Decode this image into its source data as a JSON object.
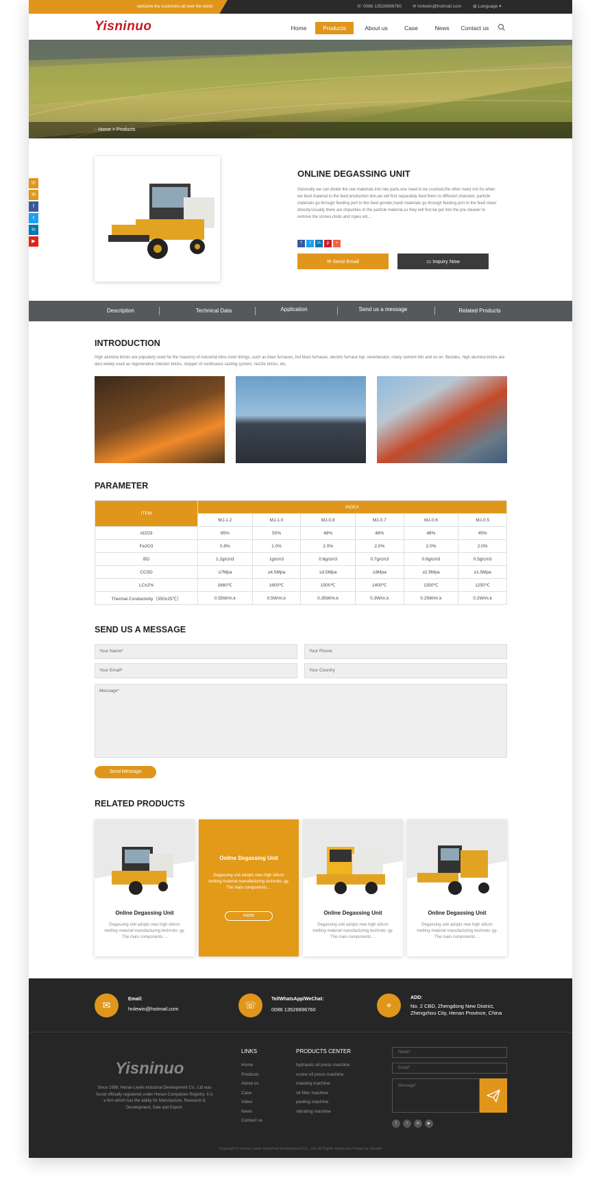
{
  "topbar": {
    "welcome": "welcome the customers all over the world",
    "phone": "0086 13526696760",
    "email": "hnlewin@hotmail.com",
    "language": "Language"
  },
  "brand": {
    "logo_text": "Yisninuo",
    "accent": "#e0961b",
    "dark": "#262626"
  },
  "nav": {
    "items": [
      {
        "label": "Home"
      },
      {
        "label": "Products"
      },
      {
        "label": "About us"
      },
      {
        "label": "Case"
      },
      {
        "label": "News"
      },
      {
        "label": "Contact us"
      }
    ],
    "active": "Products",
    "search_icon": "search-icon"
  },
  "breadcrumb": {
    "home": "Home",
    "separator": ">",
    "current": "Products"
  },
  "product": {
    "title": "ONLINE DEGASSING UNIT",
    "description": "Generally we can divide the raw materials into two parts,one need to be crushed,the other need not.So when we feed material to the feed production line,we will first separately feed them to different channels: particle materials go through feeding port to the feed grinder,mash materials go through feeding port to the feed mixer directly.Usually there are impurities in the particle material,so they will first be put into the pre-cleaner to remove the stones,clods and ropes etc...",
    "send_email": "Send Email",
    "inquiry_now": "Inquiry Now"
  },
  "tabs": [
    "Description",
    "Technical Data",
    "Application",
    "Send us a message",
    "Related Products"
  ],
  "introduction": {
    "heading": "INTRODUCTION",
    "text": "High alumina bricks are popularly used for the masonry of industrial kilns inner linings, such as blast furnaces, hot blast furnaces, electric furnace top, reverberator, rotary cement kiln and so on. Besides, high alumina bricks are also widely used as regenerative checker bricks, stopper of continuous casting system, nozzle bricks, etc."
  },
  "parameter": {
    "heading": "PARAMETER",
    "item_label": "ITEM",
    "index_label": "INDEX",
    "models": [
      "MJ-1.2",
      "MJ-1.0",
      "MJ-0.8",
      "MJ-0.7",
      "MJ-0.6",
      "MJ-0.5"
    ],
    "rows": [
      {
        "name": "Al2O3",
        "values": [
          "65%",
          "50%",
          "48%",
          "48%",
          "48%",
          "45%"
        ]
      },
      {
        "name": "Fe2O3",
        "values": [
          "0.8%",
          "1.0%",
          "2.0%",
          "2.0%",
          "2.0%",
          "2.0%"
        ]
      },
      {
        "name": "BD",
        "values": [
          "1.2g/cm3",
          "1g/cm3",
          "0.8g/cm3",
          "0.7g/cm3",
          "0.6g/cm3",
          "0.5g/cm3"
        ]
      },
      {
        "name": "CCSD",
        "values": [
          "≥7Mpa",
          "≥4.5Mpa",
          "≥3.5Mpa",
          "≥3Mpa",
          "≥2.5Mpa",
          "≥1.5Mpa"
        ]
      },
      {
        "name": "LC±2%",
        "values": [
          "1660℃",
          "1600℃",
          "1500℃",
          "1400℃",
          "1350℃",
          "1250℃"
        ]
      },
      {
        "name": "Thermal Conductivity（350±25℃）",
        "values": [
          "0.55W/m.k",
          "0.5W/m.k",
          "0.35W/m.k",
          "0.3W/m.k",
          "0.25W/m.k",
          "0.2W/m.k"
        ]
      }
    ]
  },
  "message_form": {
    "heading": "SEND US A MESSAGE",
    "name_placeholder": "Your Name*",
    "phone_placeholder": "Your Phone",
    "email_placeholder": "Your Email*",
    "country_placeholder": "Your Country",
    "message_placeholder": "Message*",
    "send_label": "Send Message"
  },
  "related": {
    "heading": "RELATED PRODUCTS",
    "cards": [
      {
        "title": "Online Degassing Unit",
        "desc": "Degassing unit adopts new high silicon melting material manufacturing technolo- gy. The main components ..."
      },
      {
        "title": "Online Degassing Unit",
        "desc": "Degassing unit adopts new high silicon melting material manufacturing technolo- gy. The main components ...",
        "more": "more"
      },
      {
        "title": "Online Degassing Unit",
        "desc": "Degassing unit adopts new high silicon melting material manufacturing technolo- gy. The main components ..."
      },
      {
        "title": "Online Degassing Unit",
        "desc": "Degassing unit adopts new high silicon melting material manufacturing technolo- gy. The main components ..."
      }
    ]
  },
  "footer": {
    "email_label": "Email:",
    "email_value": "hnlewin@hotmail.com",
    "tel_label": "Tel/WhatsApp/WeChat:",
    "tel_value": "0086 13526696760",
    "add_label": "ADD:",
    "add_line1": "No. 2 CBD, Zhengdong New District,",
    "add_line2": "Zhengzhou City, Henan Province, China",
    "logo_text": "Yisninuo",
    "about": "Since 1998,  Henan Lewin Industrial Development Co., Ltd was found officially registered under Henan Companies Registry. It is a firm which has the ability for Manufacture, Research & Development, Sale and Export.",
    "links_heading": "LINKS",
    "links": [
      "Home",
      "Products",
      "About us",
      "Case",
      "Video",
      "News",
      "Contact us"
    ],
    "products_heading": "PRODUCTS CENTER",
    "products": [
      "hydraulic oil press machine",
      "screw oil press machine",
      "roasting machine",
      "oil filter machine",
      "peeling machine",
      "vibrating machine"
    ],
    "name_placeholder": "Name*",
    "email_placeholder": "Email*",
    "message_placeholder": "Message*",
    "copyright": "Copyright © Henan Lewin Industrial Development Co., Ltd. All Rights Reserved. Power by SinoArt"
  }
}
